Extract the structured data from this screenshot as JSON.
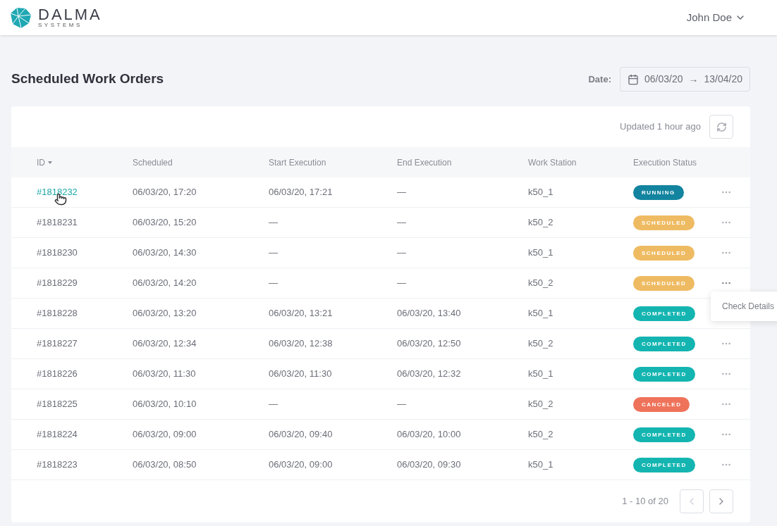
{
  "header": {
    "logo_name": "DALMA",
    "logo_tagline": "SYSTEMS",
    "user": "John Doe"
  },
  "page": {
    "title": "Scheduled Work Orders",
    "date_label": "Date:",
    "date_from": "06/03/20",
    "date_arrow": "→",
    "date_to": "13/04/20"
  },
  "table": {
    "updated": "Updated 1 hour ago",
    "columns": [
      "ID",
      "Scheduled",
      "Start Execution",
      "End Execution",
      "Work Station",
      "Execution Status"
    ],
    "rows": [
      {
        "id": "#1818232",
        "scheduled": "06/03/20, 17:20",
        "start": "06/03/20, 17:21",
        "end": "—",
        "station": "k50_1",
        "status": "RUNNING",
        "kind": "running",
        "hovered": true,
        "menu_open": false
      },
      {
        "id": "#1818231",
        "scheduled": "06/03/20, 15:20",
        "start": "—",
        "end": "—",
        "station": "k50_2",
        "status": "SCHEDULED",
        "kind": "scheduled",
        "hovered": false,
        "menu_open": false
      },
      {
        "id": "#1818230",
        "scheduled": "06/03/20, 14:30",
        "start": "—",
        "end": "—",
        "station": "k50_1",
        "status": "SCHEDULED",
        "kind": "scheduled",
        "hovered": false,
        "menu_open": false
      },
      {
        "id": "#1818229",
        "scheduled": "06/03/20, 14:20",
        "start": "—",
        "end": "—",
        "station": "k50_2",
        "status": "SCHEDULED",
        "kind": "scheduled",
        "hovered": false,
        "menu_open": true
      },
      {
        "id": "#1818228",
        "scheduled": "06/03/20, 13:20",
        "start": "06/03/20, 13:21",
        "end": "06/03/20, 13:40",
        "station": "k50_1",
        "status": "COMPLETED",
        "kind": "completed",
        "hovered": false,
        "menu_open": false
      },
      {
        "id": "#1818227",
        "scheduled": "06/03/20, 12:34",
        "start": "06/03/20, 12:38",
        "end": "06/03/20, 12:50",
        "station": "k50_2",
        "status": "COMPLETED",
        "kind": "completed",
        "hovered": false,
        "menu_open": false
      },
      {
        "id": "#1818226",
        "scheduled": "06/03/20, 11:30",
        "start": "06/03/20, 11:30",
        "end": "06/03/20, 12:32",
        "station": "k50_1",
        "status": "COMPLETED",
        "kind": "completed",
        "hovered": false,
        "menu_open": false
      },
      {
        "id": "#1818225",
        "scheduled": "06/03/20, 10:10",
        "start": "—",
        "end": "—",
        "station": "k50_2",
        "status": "CANCELED",
        "kind": "canceled",
        "hovered": false,
        "menu_open": false
      },
      {
        "id": "#1818224",
        "scheduled": "06/03/20, 09:00",
        "start": "06/03/20, 09:40",
        "end": "06/03/20, 10:00",
        "station": "k50_2",
        "status": "COMPLETED",
        "kind": "completed",
        "hovered": false,
        "menu_open": false
      },
      {
        "id": "#1818223",
        "scheduled": "06/03/20, 08:50",
        "start": "06/03/20, 09:00",
        "end": "06/03/20, 09:30",
        "station": "k50_1",
        "status": "COMPLETED",
        "kind": "completed",
        "hovered": false,
        "menu_open": false
      }
    ],
    "menu_items": [
      "Check Details"
    ],
    "pagination": {
      "range": "1 - 10 of 20",
      "prev_disabled": true,
      "next_disabled": false
    }
  }
}
